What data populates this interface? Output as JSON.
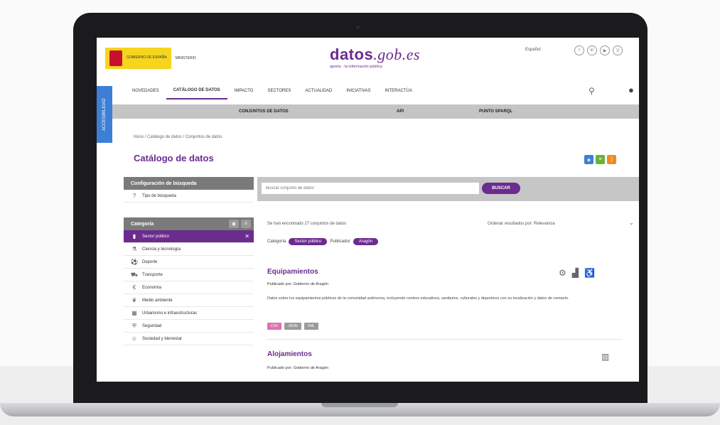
{
  "site": {
    "gov_ministry": "GOBIERNO DE ESPAÑA",
    "gov_sub": "MINISTERIO",
    "brand_name": "datos",
    "brand_domain": ".gob.es",
    "brand_tagline": "aporta - la información pública",
    "lang_label": "Español",
    "side_tab": "ACCESIBILIDAD"
  },
  "nav": {
    "items": [
      "NOVEDADES",
      "CATÁLOGO DE DATOS",
      "IMPACTO",
      "SECTORES",
      "ACTUALIDAD",
      "INICIATIVAS",
      "INTERACTÚA"
    ],
    "active_index": 1,
    "subnav": [
      "CONJUNTOS DE DATOS",
      "API",
      "PUNTO SPARQL"
    ]
  },
  "breadcrumb": "Inicio / Catálogo de datos / Conjuntos de datos",
  "page_title": "Catálogo de datos",
  "filters_panel": {
    "config_header": "Configuración de búsqueda",
    "search_type": "Tipo de búsqueda",
    "category_header": "Categoría",
    "categories": [
      {
        "label": "Sector público",
        "icon": "building-icon",
        "selected": true
      },
      {
        "label": "Ciencia y tecnología",
        "icon": "flask-icon",
        "selected": false
      },
      {
        "label": "Deporte",
        "icon": "sport-icon",
        "selected": false
      },
      {
        "label": "Transporte",
        "icon": "car-icon",
        "selected": false
      },
      {
        "label": "Economía",
        "icon": "coins-icon",
        "selected": false
      },
      {
        "label": "Medio ambiente",
        "icon": "leaf-icon",
        "selected": false
      },
      {
        "label": "Urbanismo e infraestructuras",
        "icon": "city-icon",
        "selected": false
      },
      {
        "label": "Seguridad",
        "icon": "shield-icon",
        "selected": false
      },
      {
        "label": "Sociedad y bienestar",
        "icon": "people-icon",
        "selected": false
      }
    ]
  },
  "search": {
    "placeholder": "Buscar conjunto de datos",
    "button_label": "BUSCAR"
  },
  "results": {
    "count_text": "Se han encontrado 27 conjuntos de datos",
    "order_label": "Ordenar resultados por: Relevancia",
    "active_filters_label": "Categoría",
    "chip_category": "Sector público",
    "publisher_label": "Publicador",
    "chip_publisher": "Aragón"
  },
  "datasets": [
    {
      "title": "Equipamientos",
      "publisher": "Publicado por: Gobierno de Aragón",
      "description": "Datos sobre los equipamientos públicos de la comunidad autónoma, incluyendo centros educativos, sanitarios, culturales y deportivos con su localización y datos de contacto.",
      "formats": [
        "CSV",
        "JSON",
        "XML"
      ]
    },
    {
      "title": "Alojamientos",
      "publisher": "Publicado por: Gobierno de Aragón"
    }
  ],
  "colors": {
    "brand": "#6b2b8f",
    "gov_yellow": "#f5d51e",
    "format_colors": [
      "#e06fb0",
      "#9a9a9a",
      "#9a9a9a"
    ]
  }
}
